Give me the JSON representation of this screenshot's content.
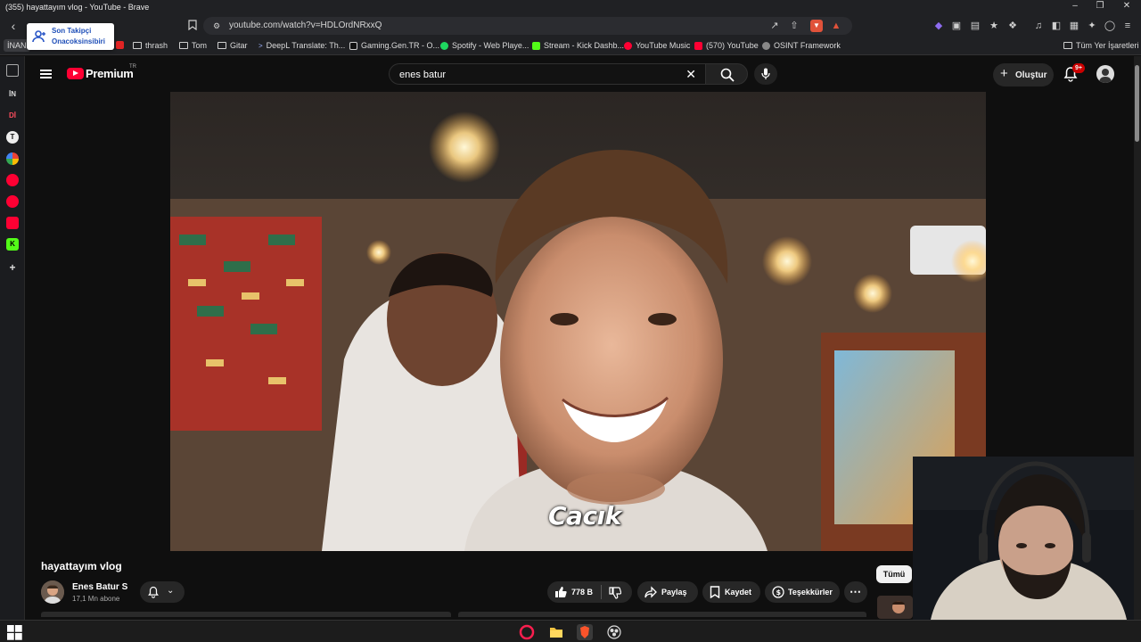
{
  "window": {
    "title": "(355) hayattayım vlog - YouTube - Brave"
  },
  "browser": {
    "url": "youtube.com/watch?v=HDLOrdNRxxQ",
    "popup": {
      "line1": "Son Takipçi",
      "line2": "Onacoksinsibiri"
    },
    "bookmarks": [
      {
        "label": "İNAN",
        "icon": "tag-icon"
      },
      {
        "label": "thrash",
        "icon": "folder-icon"
      },
      {
        "label": "Tom",
        "icon": "folder-icon"
      },
      {
        "label": "Gitar",
        "icon": "folder-icon"
      },
      {
        "label": "DeepL Translate: Th...",
        "icon": "deepl-icon"
      },
      {
        "label": "Gaming.Gen.TR - O...",
        "icon": "gaming-icon"
      },
      {
        "label": "Spotify - Web Playe...",
        "icon": "spotify-icon"
      },
      {
        "label": "Stream - Kick Dashb...",
        "icon": "kick-icon"
      },
      {
        "label": "YouTube Music",
        "icon": "ytmusic-icon"
      },
      {
        "label": "(570) YouTube",
        "icon": "youtube-icon"
      },
      {
        "label": "OSINT Framework",
        "icon": "osint-icon"
      }
    ],
    "all_bookmarks": "Tüm Yer İşaretleri",
    "sidebar_items": [
      "İN",
      "Dİ"
    ]
  },
  "youtube": {
    "logo_text": "Premium",
    "logo_region": "TR",
    "search_value": "enes batur",
    "create_label": "Oluştur",
    "notif_badge": "9+",
    "video": {
      "subtitle": "Cacık"
    },
    "title": "hayattayım vlog",
    "channel": {
      "name": "Enes Batur S",
      "subs": "17,1 Mn abone"
    },
    "likes": "778 B",
    "share_label": "Paylaş",
    "save_label": "Kaydet",
    "thanks_label": "Teşekkürler",
    "filter_chip": "Tümü"
  },
  "colors": {
    "brand_red": "#ff0033",
    "bg": "#0f0f0f",
    "chip": "#272727"
  }
}
